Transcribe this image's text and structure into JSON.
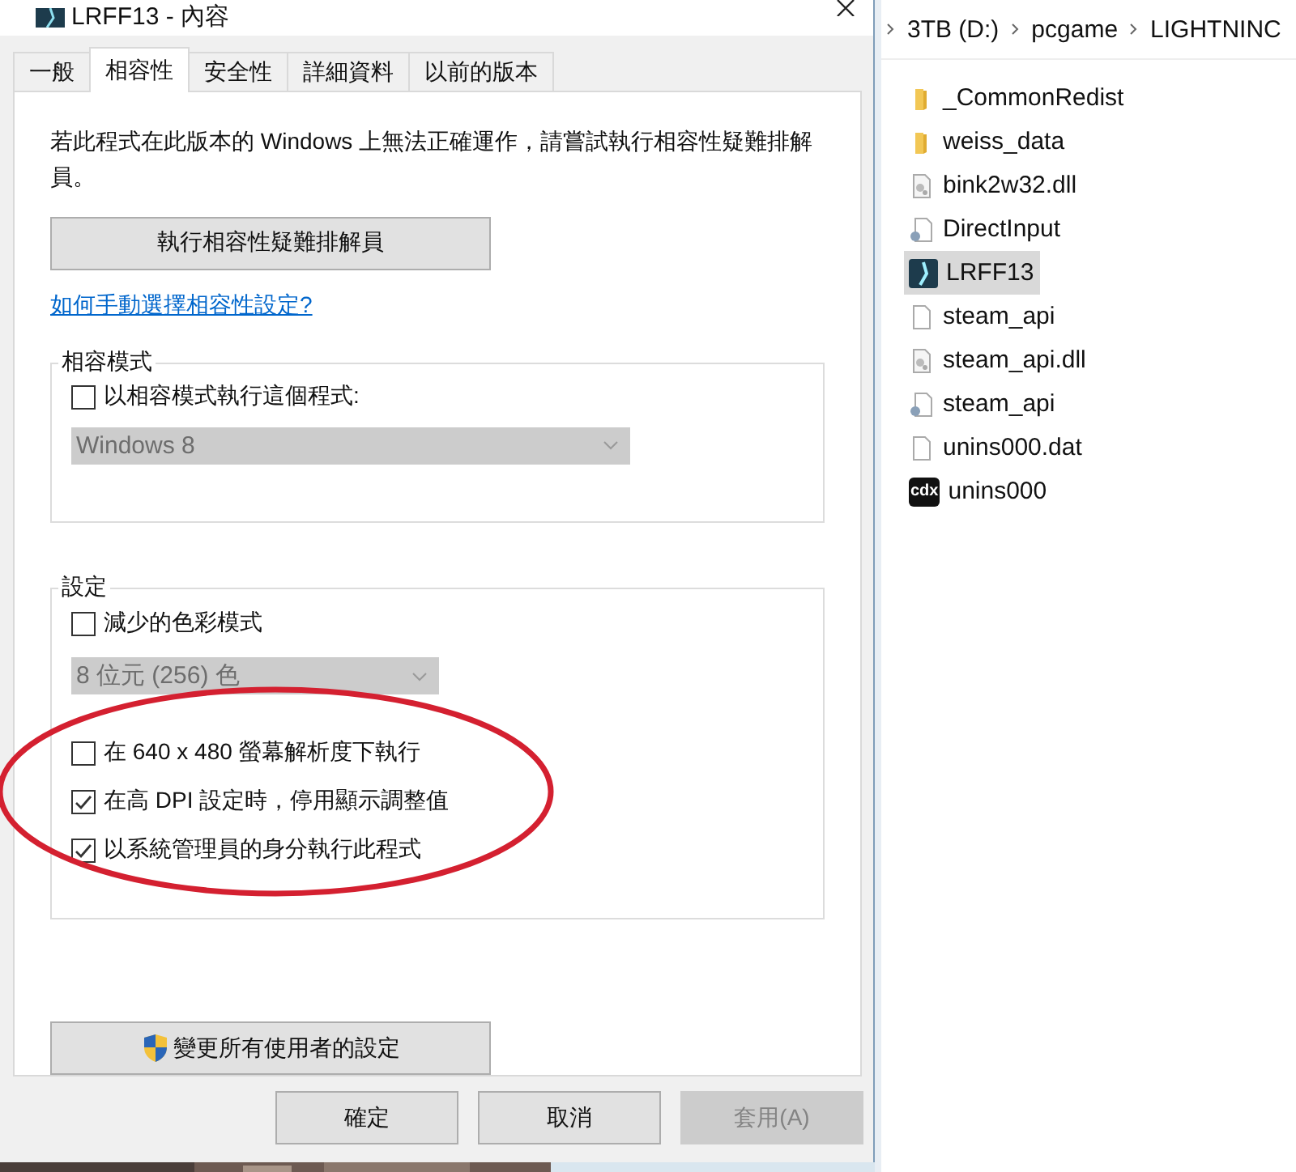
{
  "window": {
    "title": "LRFF13 - 內容"
  },
  "tabs": [
    {
      "label": "一般",
      "selected": false
    },
    {
      "label": "相容性",
      "selected": true
    },
    {
      "label": "安全性",
      "selected": false
    },
    {
      "label": "詳細資料",
      "selected": false
    },
    {
      "label": "以前的版本",
      "selected": false
    }
  ],
  "intro": "若此程式在此版本的 Windows 上無法正確運作，請嘗試執行相容性疑難排解員。",
  "troubleshooter_button": "執行相容性疑難排解員",
  "help_link": "如何手動選擇相容性設定?",
  "compat_mode": {
    "title": "相容模式",
    "checkbox": {
      "label": "以相容模式執行這個程式:",
      "checked": false
    },
    "dropdown": {
      "value": "Windows 8",
      "disabled": true
    }
  },
  "settings": {
    "title": "設定",
    "items": [
      {
        "kind": "checkbox",
        "label": "減少的色彩模式",
        "checked": false
      },
      {
        "kind": "dropdown",
        "value": "8 位元 (256) 色",
        "disabled": true
      },
      {
        "kind": "checkbox",
        "label": "在 640 x 480 螢幕解析度下執行",
        "checked": false
      },
      {
        "kind": "checkbox",
        "label": "在高 DPI 設定時，停用顯示調整值",
        "checked": true
      },
      {
        "kind": "checkbox",
        "label": "以系統管理員的身分執行此程式",
        "checked": true
      }
    ]
  },
  "annotation": {
    "kind": "ellipse",
    "color": "#d42030"
  },
  "all_users_button": "變更所有使用者的設定",
  "buttons": [
    {
      "label": "確定",
      "disabled": false
    },
    {
      "label": "取消",
      "disabled": false
    },
    {
      "label": "套用(A)",
      "disabled": true
    }
  ],
  "explorer": {
    "breadcrumb": [
      "3TB (D:)",
      "pcgame",
      "LIGHTNINC"
    ],
    "files": [
      {
        "name": "_CommonRedist",
        "kind": "folder",
        "selected": false
      },
      {
        "name": "weiss_data",
        "kind": "folder",
        "selected": false
      },
      {
        "name": "bink2w32.dll",
        "kind": "dll",
        "selected": false
      },
      {
        "name": "DirectInput",
        "kind": "config",
        "selected": false
      },
      {
        "name": "LRFF13",
        "kind": "app",
        "selected": true
      },
      {
        "name": "steam_api",
        "kind": "file",
        "selected": false
      },
      {
        "name": "steam_api.dll",
        "kind": "dll",
        "selected": false
      },
      {
        "name": "steam_api",
        "kind": "config",
        "selected": false
      },
      {
        "name": "unins000.dat",
        "kind": "file",
        "selected": false
      },
      {
        "name": "unins000",
        "kind": "cdx",
        "icon_label": "cdx",
        "selected": false
      }
    ]
  }
}
